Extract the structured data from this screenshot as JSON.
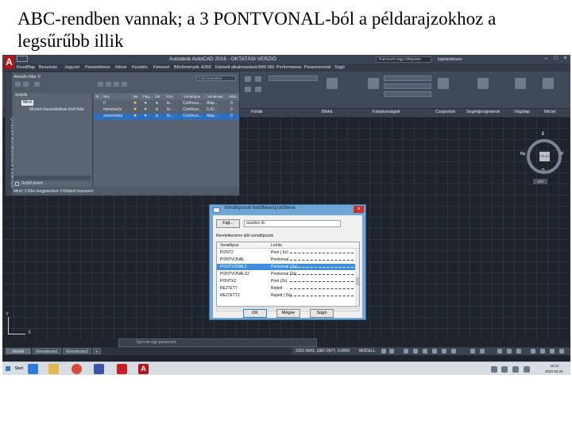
{
  "slide": {
    "title": "ABC-rendben vannak; a 3 PONTVONAL-ból a példarajzokhoz a legsűrűbb illik"
  },
  "app": {
    "logo": "A",
    "window_title": "Autodesk AutoCAD 2018 - OKTATÁSI VERZIÓ",
    "search_placeholder": "Kulcsszó vagy kifejezés",
    "user_name": "bejelentkezés",
    "minimize": "–",
    "maximize": "□",
    "close": "×"
  },
  "menu": {
    "items": [
      "Kezdőlap",
      "Beszúrás",
      "Jegyzet",
      "Paraméteres",
      "Nézet",
      "Kezelés",
      "Kimenet",
      "Bővítmények",
      "A360",
      "Kiemelt alkalmazások",
      "BIM 360",
      "Performance",
      "Parancsvonal",
      "Súgó"
    ]
  },
  "ribbon": {
    "panels": [
      "Fóliák",
      "Blokk",
      "Tulajdonságok",
      "Csoportok",
      "Segédprogramok",
      "Vágólap",
      "Nézet"
    ],
    "dropdown_value": "0"
  },
  "layer_manager": {
    "side_label": "FÓLIATULAJDONSÁGOK-KEZELŐ",
    "header": "Aktuális fólia: 0",
    "search_placeholder": "Fólia keresése",
    "filters_title": "Szűrők",
    "tree": [
      "Mind",
      "Minden használatban lévő fólia"
    ],
    "invert_filter": "Szűrő invert.",
    "columns": [
      "St...",
      "Név",
      "Be",
      "Fag...",
      "Zár",
      "Szín",
      "Vonaltípus",
      "Vonalvast.",
      "Átlát..."
    ],
    "rows": [
      {
        "name": "0",
        "color": "fe...",
        "linetype": "Continuo...",
        "lineweight": "Alap...",
        "transp": "0"
      },
      {
        "name": "méretezés",
        "color": "fe...",
        "linetype": "Continuo...",
        "lineweight": "0,40...",
        "transp": "0"
      },
      {
        "name": "szimmetria",
        "color": "fe...",
        "linetype": "Continuo...",
        "lineweight": "Alap...",
        "transp": "0"
      }
    ],
    "status": "Mind: 3 fólia megjelenítve 3 fóliából összesen"
  },
  "viewcube": {
    "north": "É",
    "south": "D",
    "west": "Ny",
    "east": "K",
    "face": "FELÜL",
    "wcs": "VKR"
  },
  "dialog": {
    "title": "Vonaltípusok betöltése/újratöltése",
    "file_button": "Fájl...",
    "file_value": "acadiso.lin",
    "available_label": "Rendelkezésre álló vonaltípusok",
    "col_linetype": "Vonaltípus",
    "col_description": "Leírás",
    "rows": [
      {
        "name": "PONT2",
        "desc": "Pont (.5x)"
      },
      {
        "name": "PONTVONAL",
        "desc": "Pontvonal"
      },
      {
        "name": "PONTVONAL2",
        "desc": "Pontvonal (.5x)"
      },
      {
        "name": "PONTVONALX2",
        "desc": "Pontvonal (2x)"
      },
      {
        "name": "PONTX2",
        "desc": "Pont (2x)"
      },
      {
        "name": "REJTETT",
        "desc": "Rejtett"
      },
      {
        "name": "REJTETT2",
        "desc": "Rejtett (.5x)"
      }
    ],
    "selected_index": 2,
    "ok": "OK",
    "cancel": "Mégse",
    "help": "Súgó"
  },
  "bottom": {
    "ucs_x": "X",
    "ucs_y": "Y",
    "command_placeholder": "Írjon be egy parancsot",
    "tabs": [
      "Modell",
      "Elrendezés1",
      "Elrendezés2",
      "+"
    ],
    "coords": "2052.0683, 1887.0677, 0.0000",
    "model": "MODELL"
  },
  "taskbar": {
    "start": "Start",
    "time": "10:22",
    "date": "2020.03.26."
  },
  "colors": {
    "autocad_red": "#b2151b",
    "selection_blue": "#3d8ee0",
    "dialog_frame": "#6ea7d8"
  }
}
